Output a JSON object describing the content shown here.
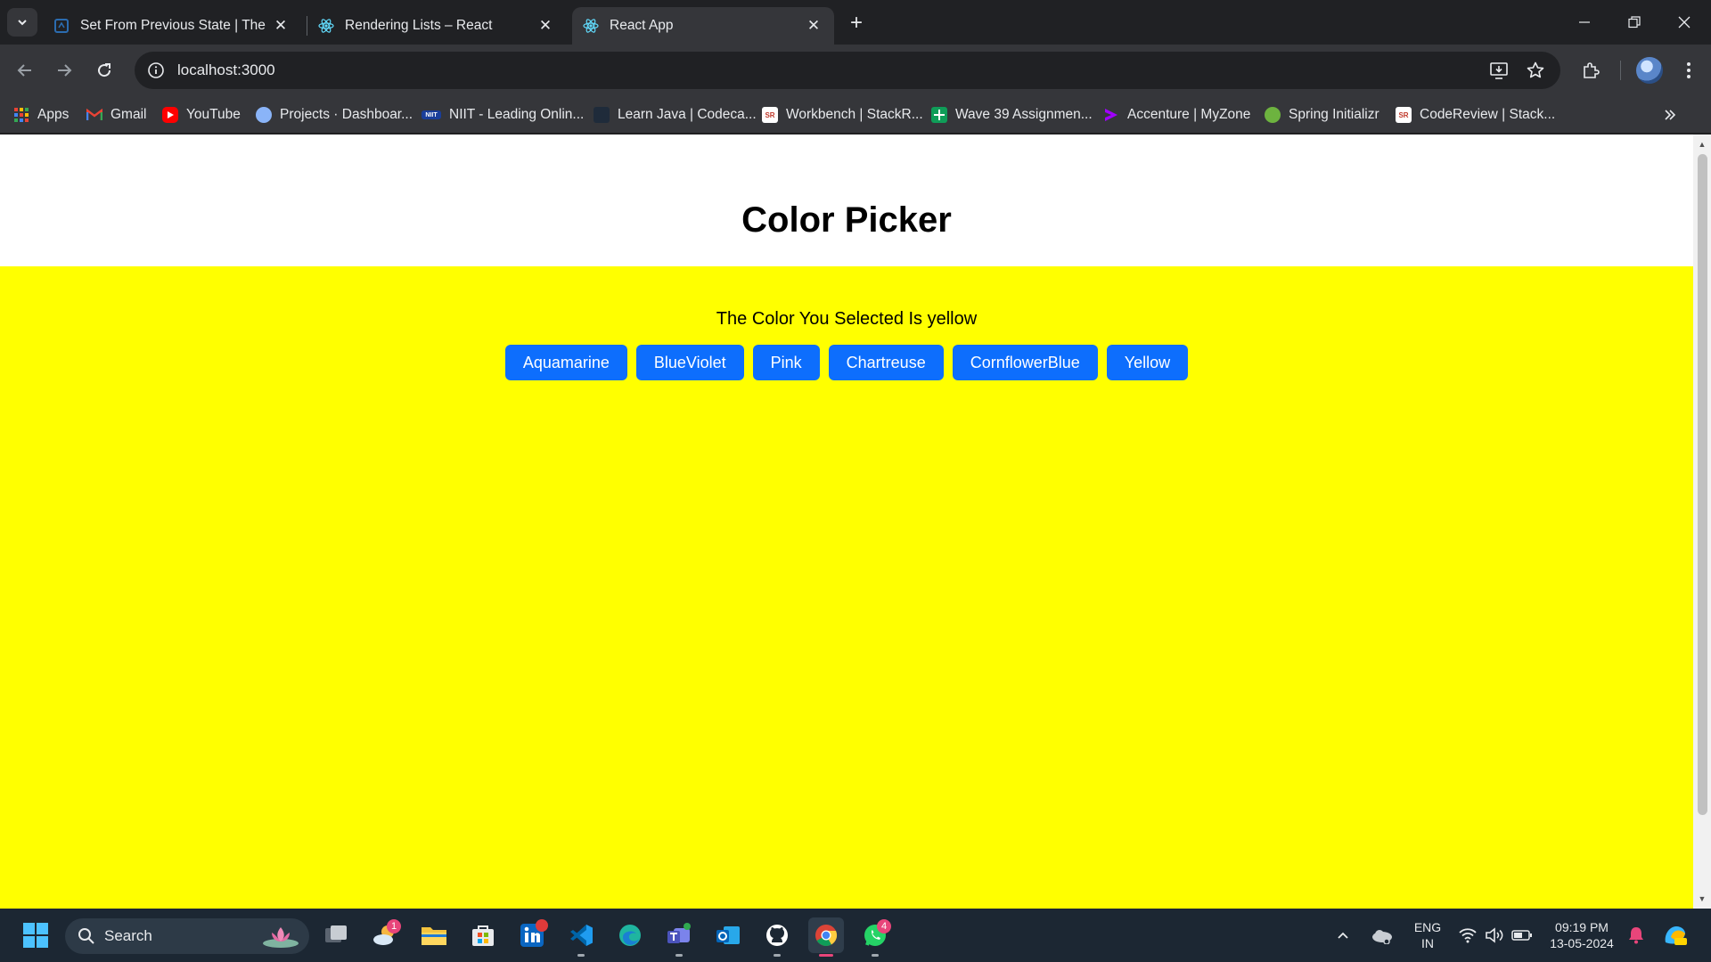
{
  "browser": {
    "tabs": [
      {
        "title": "Set From Previous State | The St",
        "icon": "scrimba-icon",
        "active": false
      },
      {
        "title": "Rendering Lists – React",
        "icon": "react-icon",
        "active": false
      },
      {
        "title": "React App",
        "icon": "react-icon",
        "active": true
      }
    ],
    "url": "localhost:3000",
    "bookmarks": [
      {
        "label": "Apps",
        "icon": "apps-grid-icon"
      },
      {
        "label": "Gmail",
        "icon": "gmail-icon"
      },
      {
        "label": "YouTube",
        "icon": "youtube-icon"
      },
      {
        "label": "Projects · Dashboar...",
        "icon": "projects-icon"
      },
      {
        "label": "NIIT - Leading Onlin...",
        "icon": "niit-icon"
      },
      {
        "label": "Learn Java | Codeca...",
        "icon": "codecademy-icon"
      },
      {
        "label": "Workbench | StackR...",
        "icon": "stackroute-icon"
      },
      {
        "label": "Wave 39 Assignmen...",
        "icon": "sheets-icon"
      },
      {
        "label": "Accenture | MyZone",
        "icon": "accenture-icon"
      },
      {
        "label": "Spring Initializr",
        "icon": "spring-icon"
      },
      {
        "label": "CodeReview | Stack...",
        "icon": "stackroute-icon"
      }
    ]
  },
  "page": {
    "title": "Color Picker",
    "selected_text": "The Color You Selected Is yellow",
    "background_color": "#ffff00",
    "buttons": [
      "Aquamarine",
      "BlueViolet",
      "Pink",
      "Chartreuse",
      "CornflowerBlue",
      "Yellow"
    ],
    "button_color": "#0d6efd"
  },
  "taskbar": {
    "search_label": "Search",
    "apps": [
      {
        "name": "task-view-icon"
      },
      {
        "name": "weather-icon",
        "badge": "1"
      },
      {
        "name": "file-explorer-icon"
      },
      {
        "name": "microsoft-store-icon"
      },
      {
        "name": "linkedin-icon",
        "badge": " "
      },
      {
        "name": "vscode-icon"
      },
      {
        "name": "edge-icon"
      },
      {
        "name": "teams-icon"
      },
      {
        "name": "outlook-icon"
      },
      {
        "name": "github-icon"
      },
      {
        "name": "chrome-icon"
      },
      {
        "name": "whatsapp-icon",
        "badge": "4"
      }
    ],
    "language_line1": "ENG",
    "language_line2": "IN",
    "time": "09:19 PM",
    "date": "13-05-2024"
  }
}
